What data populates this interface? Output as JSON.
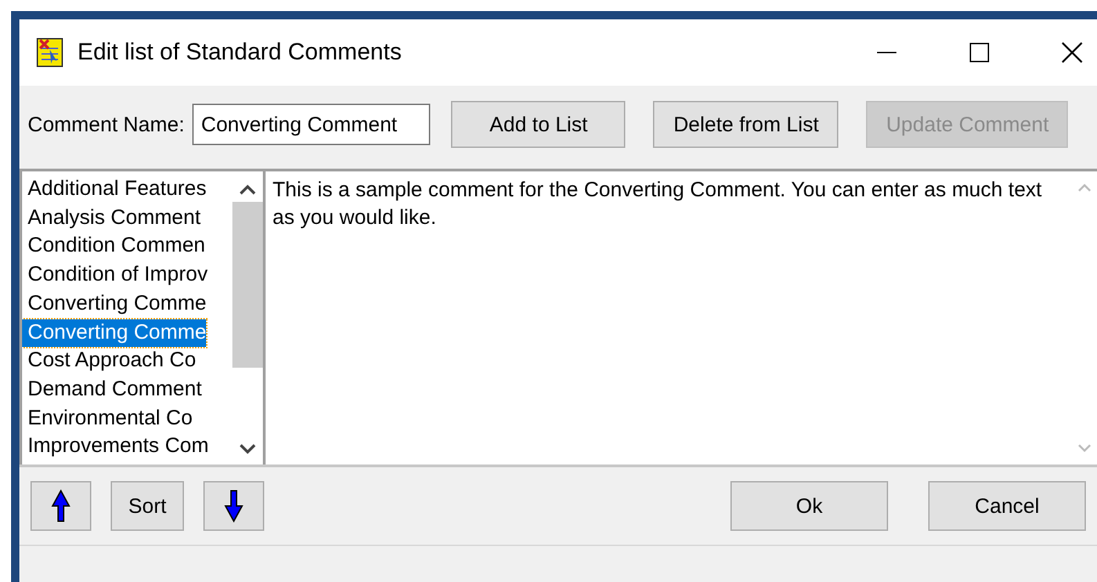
{
  "window": {
    "title": "Edit list of Standard Comments"
  },
  "toolbar": {
    "name_label": "Comment Name:",
    "name_value": "Converting Comment",
    "buttons": [
      {
        "label": "Add to List",
        "disabled": false
      },
      {
        "label": "Delete from List",
        "disabled": false
      },
      {
        "label": "Update Comment",
        "disabled": true
      }
    ]
  },
  "comments_list": [
    {
      "label": "Additional Features",
      "selected": false
    },
    {
      "label": "Analysis Comment",
      "selected": false
    },
    {
      "label": "Condition Commen",
      "selected": false
    },
    {
      "label": "Condition of Improv",
      "selected": false
    },
    {
      "label": "Converting Comme",
      "selected": false
    },
    {
      "label": "Converting Comme",
      "selected": true
    },
    {
      "label": "Cost Approach Co",
      "selected": false
    },
    {
      "label": "Demand Comment",
      "selected": false
    },
    {
      "label": "Environmental Co",
      "selected": false
    },
    {
      "label": "Improvements Com",
      "selected": false
    }
  ],
  "comment_text": "This is a sample comment for the Converting Comment. You can enter as much text as you would like.",
  "bottom_buttons": [
    {
      "kind": "up"
    },
    {
      "kind": "text",
      "label": "Sort"
    },
    {
      "kind": "down"
    }
  ],
  "dialog_buttons": [
    "Ok",
    "Cancel"
  ]
}
